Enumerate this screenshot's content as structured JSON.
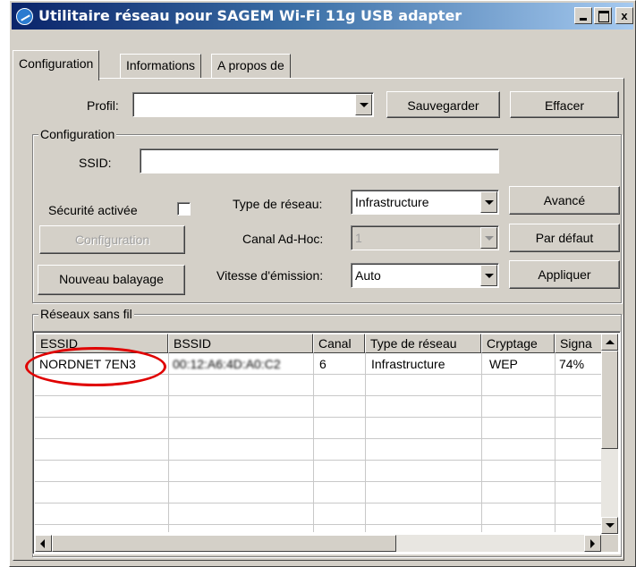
{
  "window": {
    "title": "Utilitaire réseau pour SAGEM Wi-Fi 11g USB adapter",
    "controls": {
      "minimize": "",
      "maximize": "",
      "close": "x"
    }
  },
  "tabs": [
    "Configuration",
    "Informations",
    "A propos de"
  ],
  "profile": {
    "label": "Profil:",
    "value": "",
    "save_button": "Sauvegarder",
    "delete_button": "Effacer"
  },
  "configuration": {
    "group_title": "Configuration",
    "ssid_label": "SSID:",
    "ssid_value": "",
    "security_label": "Sécurité activée",
    "security_checked": false,
    "config_button": "Configuration",
    "rescan_button": "Nouveau balayage",
    "network_type_label": "Type de réseau:",
    "network_type_value": "Infrastructure",
    "adhoc_channel_label": "Canal Ad-Hoc:",
    "adhoc_channel_value": "1",
    "tx_rate_label": "Vitesse d'émission:",
    "tx_rate_value": "Auto",
    "advanced_button": "Avancé",
    "default_button": "Par défaut",
    "apply_button": "Appliquer"
  },
  "wireless_networks": {
    "group_title": "Réseaux sans fil",
    "columns": [
      "ESSID",
      "BSSID",
      "Canal",
      "Type de réseau",
      "Cryptage",
      "Signa"
    ],
    "rows": [
      {
        "essid": "NORDNET 7EN3",
        "bssid": "00:12:A6:4D:A0:C2",
        "channel": "6",
        "type": "Infrastructure",
        "encryption": "WEP",
        "signal": "74%"
      }
    ]
  },
  "colors": {
    "face": "#d4d0c8",
    "highlight_ellipse": "#e00000",
    "title_start": "#0a246a",
    "title_end": "#a6caf0"
  }
}
